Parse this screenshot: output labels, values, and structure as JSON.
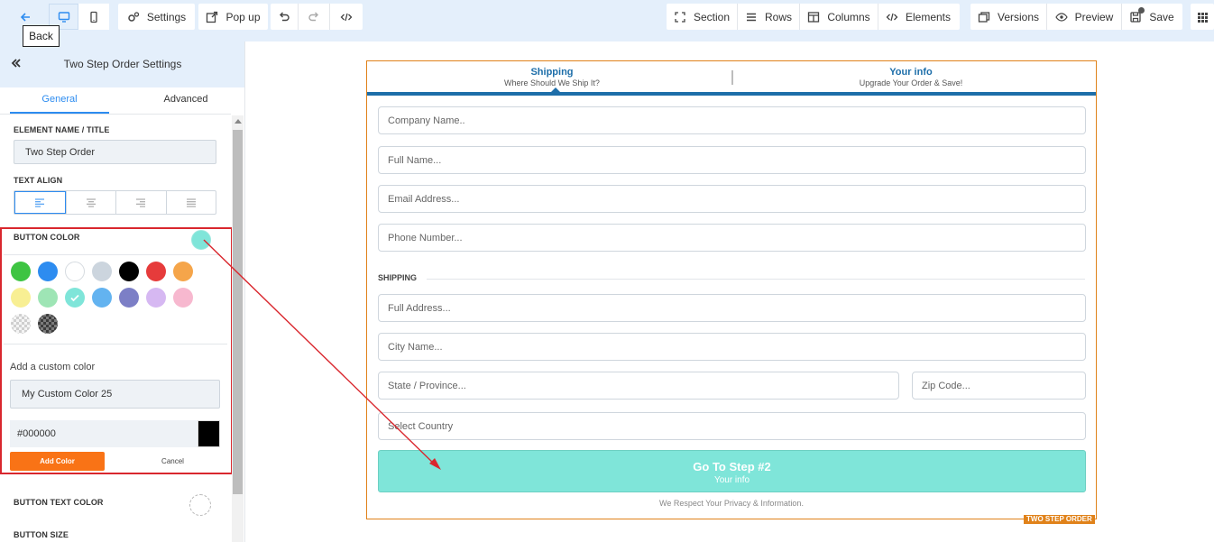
{
  "toolbar": {
    "back_tooltip": "Back",
    "settings": "Settings",
    "popup": "Pop up",
    "section": "Section",
    "rows": "Rows",
    "columns": "Columns",
    "elements": "Elements",
    "versions": "Versions",
    "preview": "Preview",
    "save": "Save"
  },
  "sidebar": {
    "title": "Two Step Order Settings",
    "tabs": [
      "General",
      "Advanced"
    ],
    "element_name_label": "ELEMENT NAME / TITLE",
    "element_name_value": "Two Step Order",
    "text_align_label": "TEXT ALIGN",
    "button_color_label": "BUTTON COLOR",
    "button_color_value": "#7fe5d9",
    "swatches_row1": [
      "#3ec442",
      "#2d8cf0",
      "#ffffff",
      "#ccd5de",
      "#000000",
      "#e63b3b",
      "#f5a54a"
    ],
    "swatches_row2": [
      "#f8ef93",
      "#9ee5b5",
      "#7fe5d9",
      "#63b3f0",
      "#7c7fc6",
      "#d6b8f2",
      "#f7b8cf"
    ],
    "selected_swatch": "#7fe5d9",
    "custom_color_label": "Add a custom color",
    "custom_color_name": "My Custom Color 25",
    "custom_color_hex": "#000000",
    "add_color_btn": "Add Color",
    "cancel_btn": "Cancel",
    "button_text_color_label": "BUTTON TEXT COLOR",
    "button_size_label": "BUTTON SIZE",
    "accent": "#2d8cf0",
    "highlight": "#d9272e"
  },
  "form": {
    "step1_title": "Shipping",
    "step1_sub": "Where Should We Ship It?",
    "step2_title": "Your info",
    "step2_sub": "Upgrade Your Order & Save!",
    "company": "Company Name..",
    "fullname": "Full Name...",
    "email": "Email Address...",
    "phone": "Phone Number...",
    "shipping_label": "SHIPPING",
    "address": "Full Address...",
    "city": "City Name...",
    "state": "State / Province...",
    "zip": "Zip Code...",
    "country": "Select Country",
    "btn_title": "Go To Step #2",
    "btn_sub": "Your info",
    "privacy": "We Respect Your Privacy & Information.",
    "badge": "TWO STEP ORDER",
    "brand_color": "#1d6ea9",
    "border_color": "#e0821a"
  }
}
